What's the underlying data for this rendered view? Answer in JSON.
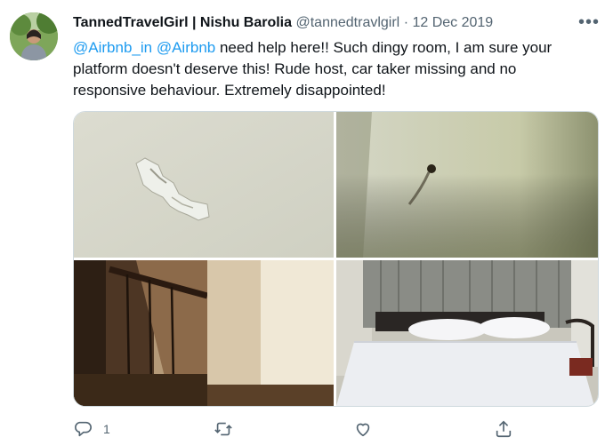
{
  "tweet": {
    "display_name": "TannedTravelGirl | Nishu Barolia",
    "handle": "@tannedtravlgirl",
    "separator": "·",
    "date": "12 Dec 2019",
    "more_label": "•••",
    "mention_1": "@Airbnb_in",
    "mention_2": "@Airbnb",
    "body_text": " need help here!! Such dingy room, I am sure your platform doesn't deserve this! Rude host, car taker missing and no responsive behaviour. Extremely disappointed!"
  },
  "media": {
    "photos": [
      "damaged-wall-photo",
      "stained-wall-photo",
      "staircase-photo",
      "bed-photo"
    ]
  },
  "actions": {
    "reply_count": "1",
    "icons": [
      "reply-icon",
      "retweet-icon",
      "like-icon",
      "share-icon"
    ]
  },
  "colors": {
    "link": "#1d9bf0",
    "secondary_text": "#536471"
  }
}
